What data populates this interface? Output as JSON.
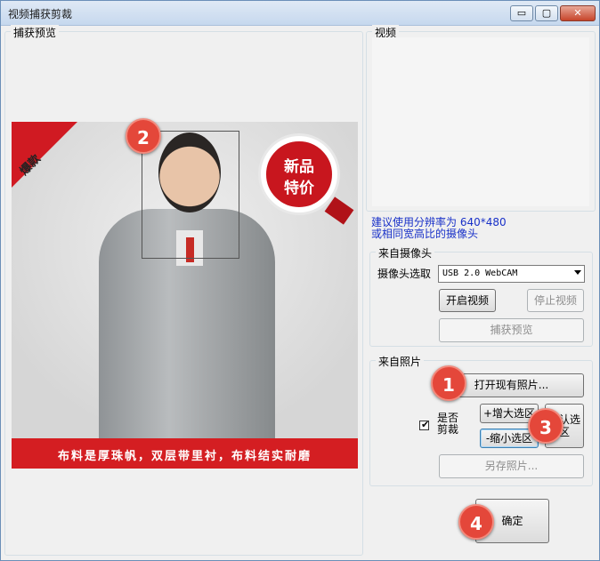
{
  "window": {
    "title": "视频捕获剪裁",
    "controls": {
      "minimize": "▭",
      "maximize": "▢",
      "close": "✕"
    }
  },
  "preview": {
    "group_label": "捕获预览",
    "image": {
      "corner_text": "爆款",
      "badge_line1": "新品",
      "badge_line2": "特价",
      "caption": "布料是厚珠帆，双层带里衬，布料结实耐磨"
    }
  },
  "video": {
    "group_label": "视频"
  },
  "hint": {
    "line1": "建议使用分辨率为 640*480",
    "line2": "或相同宽高比的摄像头"
  },
  "camera": {
    "group_label": "来自摄像头",
    "select_label": "摄像头选取",
    "select_value": "USB 2.0 WebCAM",
    "start_button": "开启视频",
    "stop_button": "停止视频",
    "capture_button": "捕获预览"
  },
  "photo": {
    "group_label": "来自照片",
    "open_button": "打开现有照片...",
    "crop_checkbox_label": "是否剪裁",
    "crop_checked": true,
    "enlarge_button": "+增大选区",
    "shrink_button": "-缩小选区",
    "confirm_button": "确认选区",
    "save_button": "另存照片..."
  },
  "ok_button": "确定",
  "markers": [
    "1",
    "2",
    "3",
    "4"
  ],
  "colors": {
    "accent_red": "#e4473a",
    "hint_blue": "#1830c8",
    "caption_red": "#d41e22"
  }
}
